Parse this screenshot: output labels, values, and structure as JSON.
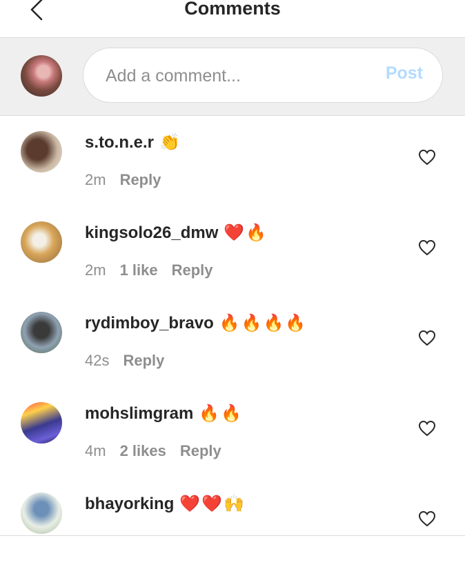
{
  "header": {
    "title": "Comments"
  },
  "composer": {
    "placeholder": "Add a comment...",
    "post_label": "Post"
  },
  "comments": [
    {
      "username": "s.to.n.e.r",
      "emoji": "👏",
      "time": "2m",
      "likes": "",
      "reply": "Reply"
    },
    {
      "username": "kingsolo26_dmw",
      "emoji": "❤️🔥",
      "time": "2m",
      "likes": "1 like",
      "reply": "Reply"
    },
    {
      "username": "rydimboy_bravo",
      "emoji": "🔥🔥🔥🔥",
      "time": "42s",
      "likes": "",
      "reply": "Reply"
    },
    {
      "username": "mohslimgram",
      "emoji": "🔥🔥",
      "time": "4m",
      "likes": "2 likes",
      "reply": "Reply"
    },
    {
      "username": "bhayorking",
      "emoji": "❤️❤️🙌",
      "time": "",
      "likes": "",
      "reply": ""
    }
  ],
  "colors": {
    "post_disabled": "#b3dbff",
    "meta": "#8e8e8e",
    "text": "#262626",
    "heart_emoji": "#e0457b"
  },
  "icons": {
    "back": "chevron-left-icon",
    "like": "heart-outline-icon"
  }
}
